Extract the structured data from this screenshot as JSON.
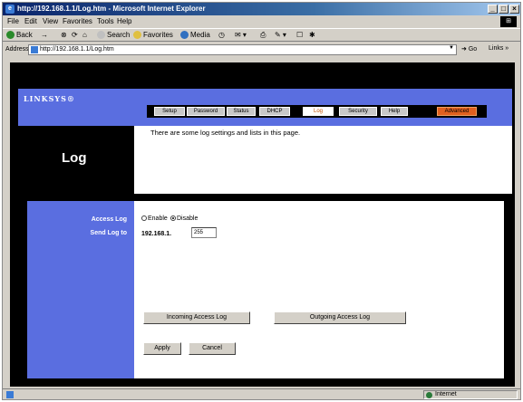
{
  "window": {
    "title": "http://192.168.1.1/Log.htm - Microsoft Internet Explorer",
    "controls": [
      "_",
      "□",
      "×"
    ]
  },
  "menubar": [
    "File",
    "Edit",
    "View",
    "Favorites",
    "Tools",
    "Help"
  ],
  "toolbar": {
    "back": "Back",
    "forward": "→",
    "stop": "⊗",
    "refresh": "⟳",
    "home": "⌂",
    "search": "Search",
    "favorites": "Favorites",
    "media": "Media",
    "history": "◷"
  },
  "address": {
    "label": "Address",
    "url": "http://192.168.1.1/Log.htm",
    "go": "Go",
    "links": "Links »"
  },
  "router": {
    "brand": "LINKSYS®",
    "tabs": [
      "Setup",
      "Password",
      "Status",
      "DHCP",
      "Log",
      "Security",
      "Help"
    ],
    "active_tab": "Log",
    "advanced_tab": "Advanced",
    "page_title": "Log",
    "intro": "There are some log settings and lists in this page."
  },
  "form": {
    "access_log_label": "Access Log",
    "send_log_label": "Send Log to",
    "enable_label": "Enable",
    "disable_label": "Disable",
    "access_log_value": "Disable",
    "ip_prefix": "192.168.1.",
    "ip_last_octet": "255"
  },
  "buttons": {
    "incoming": "Incoming Access Log",
    "outgoing": "Outgoing Access Log",
    "apply": "Apply",
    "cancel": "Cancel"
  },
  "status": {
    "zone": "Internet"
  },
  "colors": {
    "brand_blue": "#5a6ee0",
    "advanced_orange": "#e06020"
  }
}
